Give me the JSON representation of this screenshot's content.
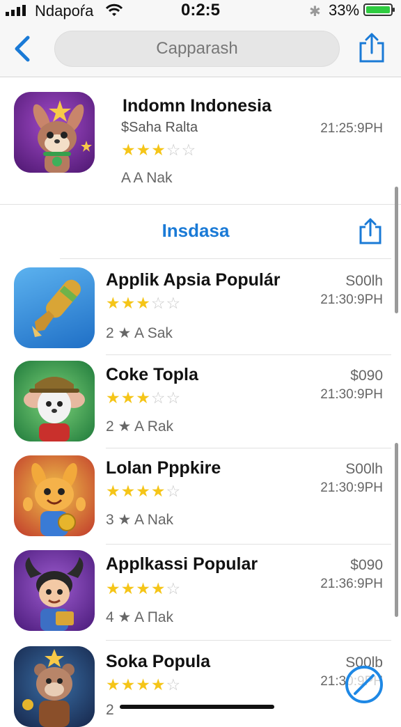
{
  "status_bar": {
    "carrier": "Ndapoŕa",
    "time": "0:2:5",
    "battery_pct": "33%"
  },
  "nav": {
    "search_text": "Capparash"
  },
  "featured": {
    "name": "Indomn Indonesia",
    "subtitle": "$Saha Ralta",
    "time": "21:25:9PH",
    "rating": 3,
    "meta": "A  A Nak"
  },
  "section": {
    "title": "Insdasa"
  },
  "apps": [
    {
      "name": "Applik Apsia Populár",
      "price": "S00lh",
      "time": "21:30:9PH",
      "rating": 3.5,
      "meta": "2 ★ A Sak"
    },
    {
      "name": "Coke Topla",
      "price": "$090",
      "time": "21:30:9PH",
      "rating": 3.5,
      "meta": "2 ★ A Rak"
    },
    {
      "name": "Lolan Pppkire",
      "price": "S00lh",
      "time": "21:30:9PH",
      "rating": 4.5,
      "meta": "3 ★ A Nak"
    },
    {
      "name": "Applkassi Popular",
      "price": "$090",
      "time": "21:36:9PH",
      "rating": 4.5,
      "meta": "4 ★ A Пak"
    },
    {
      "name": "Soka Popula",
      "price": "S00lb",
      "time": "21:30:9PH",
      "rating": 4.5,
      "meta": "2"
    }
  ],
  "colors": {
    "accent": "#1a7ad6",
    "star": "#f5c518"
  }
}
